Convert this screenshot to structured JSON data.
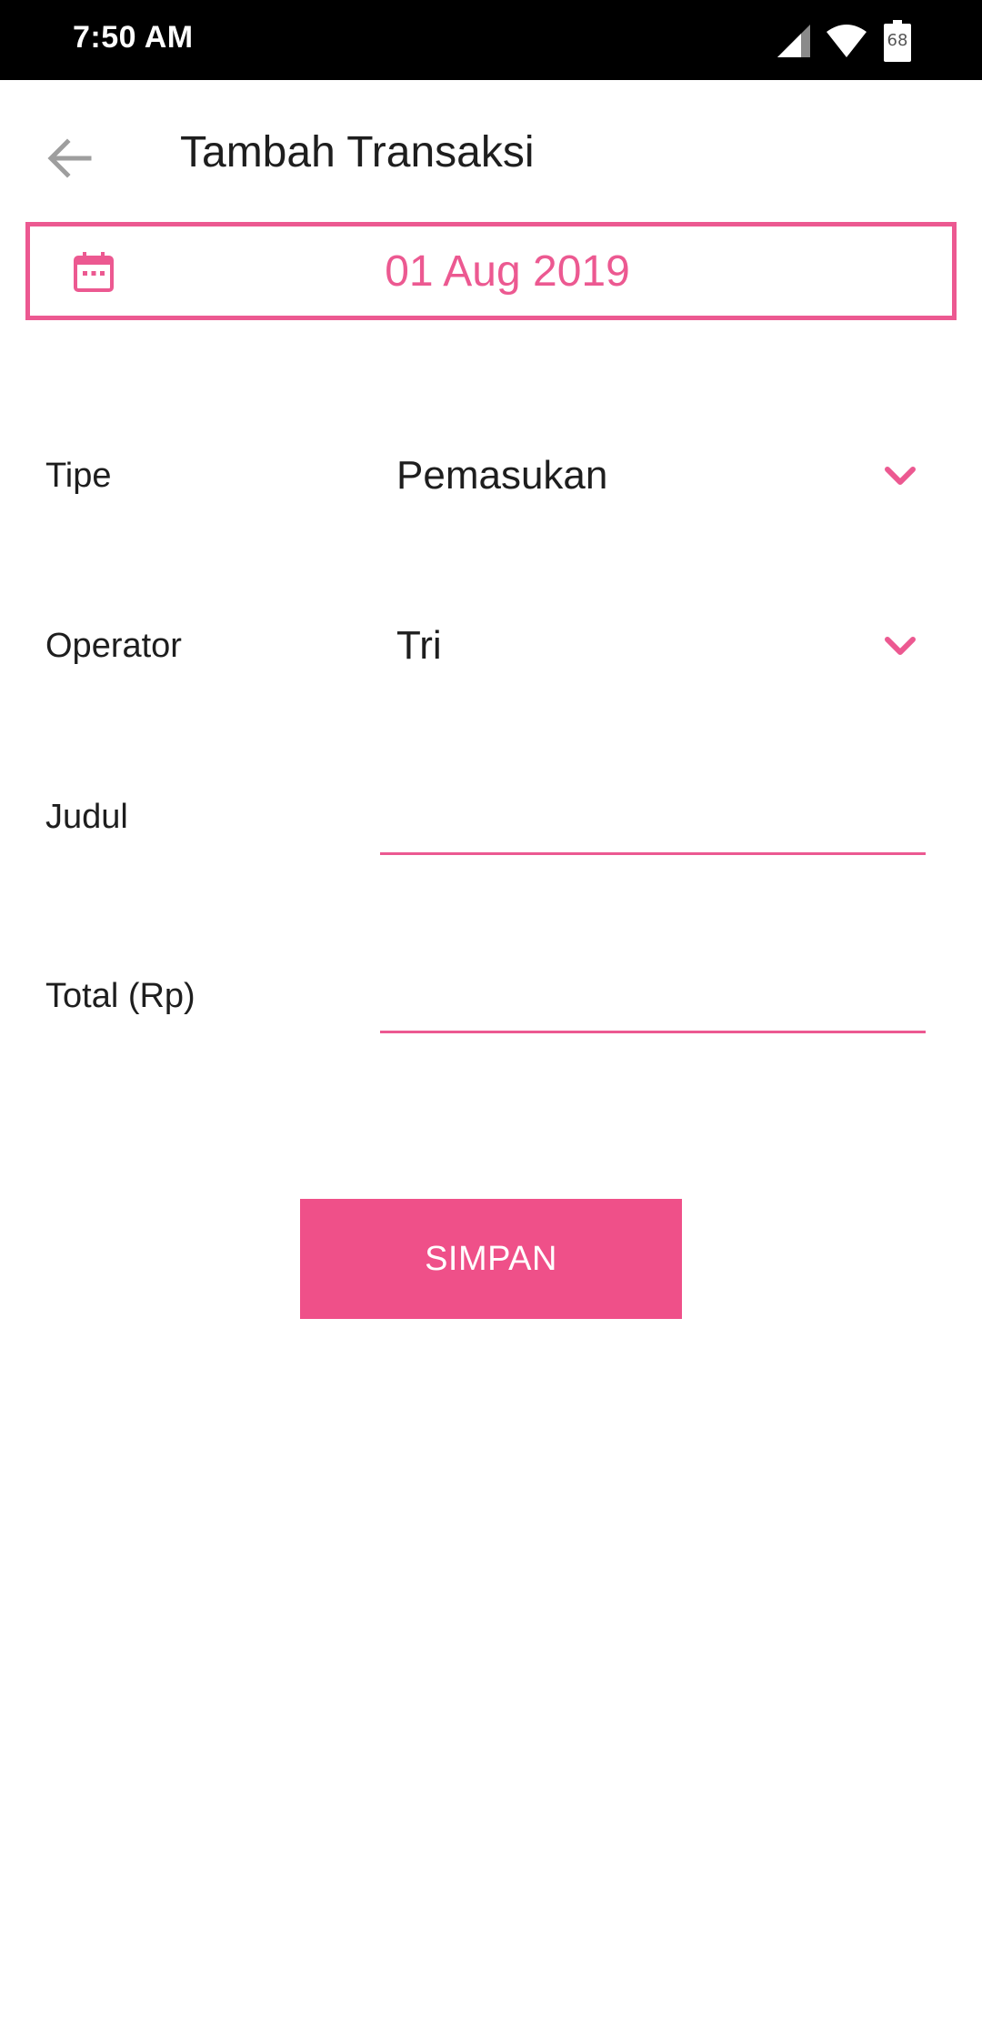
{
  "status_bar": {
    "time": "7:50 AM",
    "battery_level": "68",
    "icons": [
      "signal-icon",
      "wifi-icon",
      "battery-icon"
    ]
  },
  "app_bar": {
    "back_icon": "arrow-left-icon",
    "title": "Tambah Transaksi"
  },
  "date_selector": {
    "icon": "calendar-icon",
    "value": "01 Aug 2019"
  },
  "form": {
    "type": {
      "label": "Tipe",
      "selected": "Pemasukan"
    },
    "operator": {
      "label": "Operator",
      "selected": "Tri"
    },
    "title": {
      "label": "Judul",
      "value": "",
      "placeholder": ""
    },
    "total": {
      "label": "Total (Rp)",
      "value": "",
      "placeholder": ""
    }
  },
  "actions": {
    "save_label": "SIMPAN"
  },
  "colors": {
    "accent": "#ec5991",
    "button": "#ef5089",
    "status_bar": "#000000",
    "background": "#ffffff"
  }
}
